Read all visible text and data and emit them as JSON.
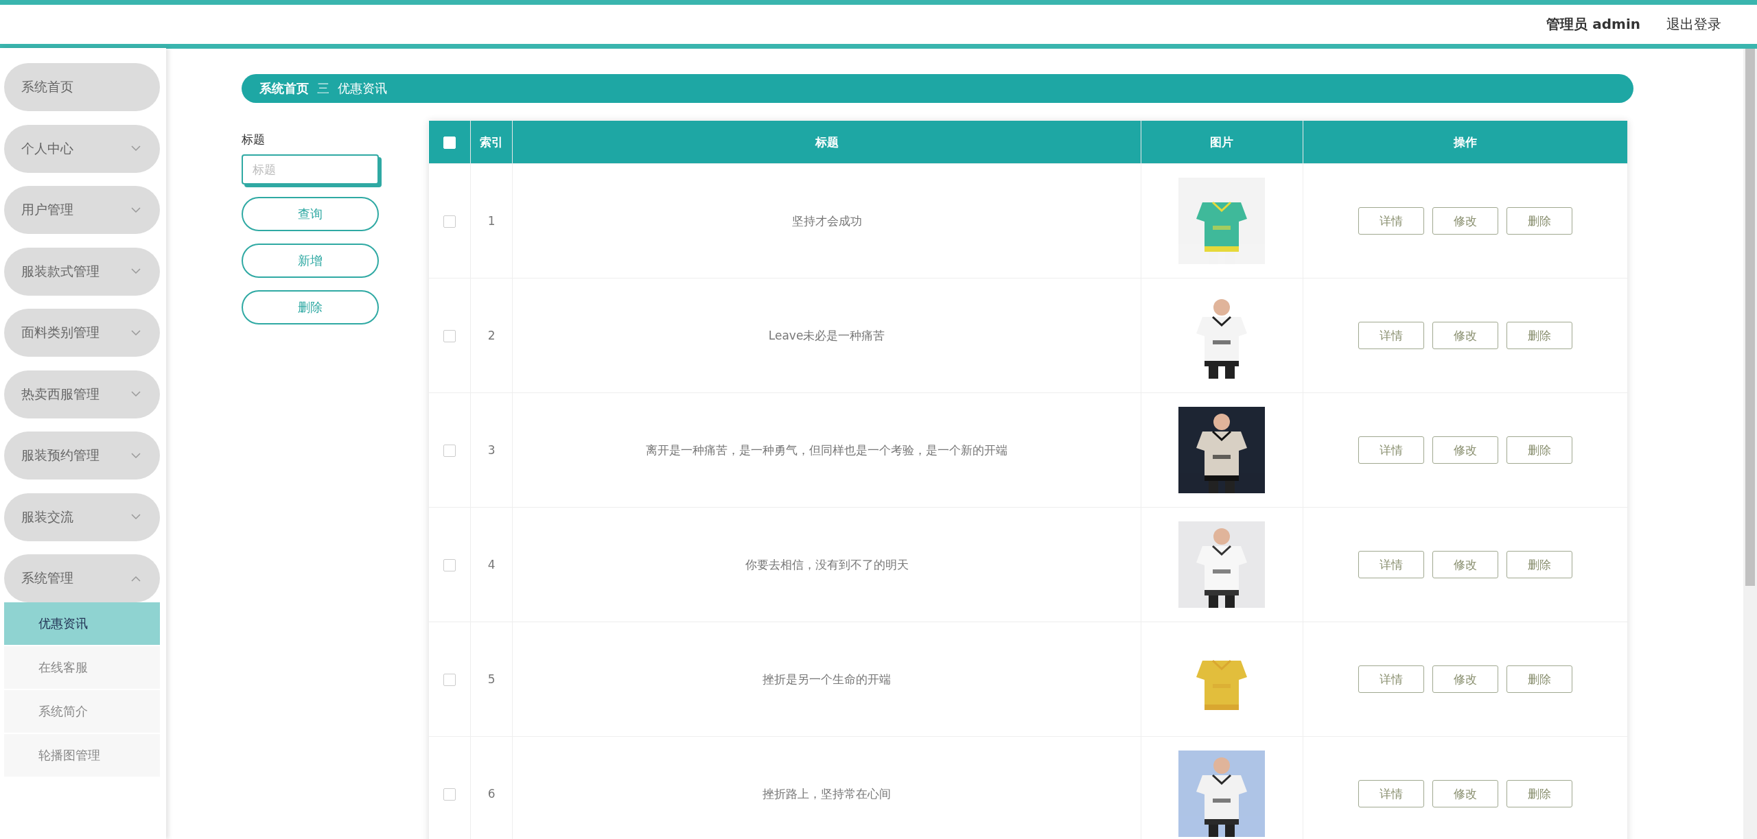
{
  "header": {
    "user_label": "管理员 admin",
    "logout": "退出登录"
  },
  "sidebar": {
    "items": [
      {
        "label": "系统首页",
        "expandable": false,
        "expanded": false
      },
      {
        "label": "个人中心",
        "expandable": true,
        "expanded": false
      },
      {
        "label": "用户管理",
        "expandable": true,
        "expanded": false
      },
      {
        "label": "服装款式管理",
        "expandable": true,
        "expanded": false
      },
      {
        "label": "面料类别管理",
        "expandable": true,
        "expanded": false
      },
      {
        "label": "热卖西服管理",
        "expandable": true,
        "expanded": false
      },
      {
        "label": "服装预约管理",
        "expandable": true,
        "expanded": false
      },
      {
        "label": "服装交流",
        "expandable": true,
        "expanded": false
      },
      {
        "label": "系统管理",
        "expandable": true,
        "expanded": true,
        "children": [
          {
            "label": "优惠资讯",
            "selected": true
          },
          {
            "label": "在线客服",
            "selected": false
          },
          {
            "label": "系统简介",
            "selected": false
          },
          {
            "label": "轮播图管理",
            "selected": false
          }
        ]
      }
    ]
  },
  "breadcrumb": {
    "home": "系统首页",
    "separator": "三",
    "current": "优惠资讯"
  },
  "search": {
    "label": "标题",
    "placeholder": "标题",
    "buttons": [
      "查询",
      "新增",
      "删除"
    ]
  },
  "table": {
    "select_all_checked": false,
    "columns": [
      "索引",
      "标题",
      "图片",
      "操作"
    ],
    "rows": [
      {
        "checked": false,
        "index": "1",
        "title": "坚持才会成功",
        "image": {
          "kind": "picture"
        },
        "actions": [
          "详情",
          "修改",
          "删除"
        ]
      },
      {
        "checked": false,
        "index": "2",
        "title": "Leave未必是一种痛苦",
        "image": {
          "kind": "picture"
        },
        "actions": [
          "详情",
          "修改",
          "删除"
        ]
      },
      {
        "checked": false,
        "index": "3",
        "title": "离开是一种痛苦，是一种勇气，但同样也是一个考验，是一个新的开端",
        "image": {
          "kind": "picture"
        },
        "actions": [
          "详情",
          "修改",
          "删除"
        ]
      },
      {
        "checked": false,
        "index": "4",
        "title": "你要去相信，没有到不了的明天",
        "image": {
          "kind": "picture"
        },
        "actions": [
          "详情",
          "修改",
          "删除"
        ]
      },
      {
        "checked": false,
        "index": "5",
        "title": "挫折是另一个生命的开端",
        "image": {
          "kind": "picture"
        },
        "actions": [
          "详情",
          "修改",
          "删除"
        ]
      },
      {
        "checked": false,
        "index": "6",
        "title": "挫折路上，坚持常在心间",
        "image": {
          "kind": "picture"
        },
        "actions": [
          "详情",
          "修改",
          "删除"
        ]
      }
    ]
  }
}
